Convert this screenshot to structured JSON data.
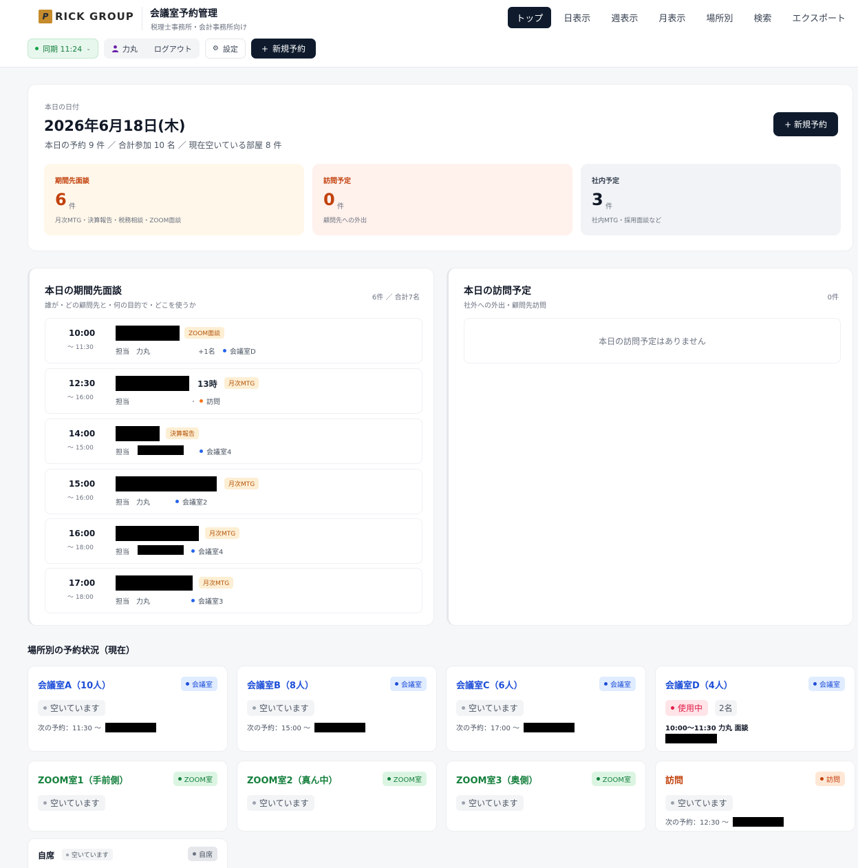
{
  "header": {
    "logo_mark": "P",
    "logo_text": "RICK GROUP",
    "app_title": "会議室予約管理",
    "app_subtitle": "税理士事務所・会計事務所向け",
    "nav": [
      "トップ",
      "日表示",
      "週表示",
      "月表示",
      "場所別",
      "検索",
      "エクスポート"
    ],
    "sync_label": "同期 11:24",
    "user_name": "力丸",
    "logout_label": "ログアウト",
    "settings_label": "設定",
    "new_label": "新規予約"
  },
  "summary": {
    "label": "本日の日付",
    "date": "2026年6月18日(木)",
    "stats": "本日の予約 9 件 ／ 合計参加 10 名 ／ 現在空いている部屋 8 件",
    "new_label": "新規予約",
    "boxes": [
      {
        "title": "期間先面談",
        "count": "6",
        "unit": "件",
        "desc": "月次MTG・決算報告・税務相談・ZOOM面談"
      },
      {
        "title": "訪問予定",
        "count": "0",
        "unit": "件",
        "desc": "顧問先への外出"
      },
      {
        "title": "社内予定",
        "count": "3",
        "unit": "件",
        "desc": "社内MTG・採用面談など"
      }
    ]
  },
  "meetings": {
    "title": "本日の期間先面談",
    "subtitle": "誰が・どの顧問先と・何の目的で・どこを使うか",
    "count": "6件 ／ 合計7名",
    "items": [
      {
        "start": "10:00",
        "end": "〜 11:30",
        "tag": "ZOOM面談",
        "staff": "担当　力丸",
        "extra": "+1名",
        "room": "会議室D"
      },
      {
        "start": "12:30",
        "end": "〜 16:00",
        "note": "13時",
        "tag": "月次MTG",
        "staff": "担当",
        "extra": "・",
        "room": "訪問"
      },
      {
        "start": "14:00",
        "end": "〜 15:00",
        "tag": "決算報告",
        "staff": "担当",
        "room": "会議室4"
      },
      {
        "start": "15:00",
        "end": "〜 16:00",
        "tag": "月次MTG",
        "staff": "担当　力丸",
        "room": "会議室2"
      },
      {
        "start": "16:00",
        "end": "〜 18:00",
        "tag": "月次MTG",
        "staff": "担当",
        "room": "会議室4"
      },
      {
        "start": "17:00",
        "end": "〜 18:00",
        "tag": "月次MTG",
        "staff": "担当　力丸",
        "room": "会議室3"
      }
    ]
  },
  "visits": {
    "title": "本日の訪問予定",
    "subtitle": "社外への外出・顧問先訪問",
    "count": "0件",
    "empty": "本日の訪問予定はありません"
  },
  "locations": {
    "title": "場所別の予約状況（現在）",
    "items": [
      {
        "name": "会議室A（10人）",
        "type": "会議室",
        "status": "空いています",
        "next": "次の予約：11:30 〜"
      },
      {
        "name": "会議室B（8人）",
        "type": "会議室",
        "status": "空いています",
        "next": "次の予約：15:00 〜"
      },
      {
        "name": "会議室C（6人）",
        "type": "会議室",
        "status": "空いています",
        "next": "次の予約：17:00 〜"
      },
      {
        "name": "会議室D（4人）",
        "type": "会議室",
        "status": "使用中",
        "people": "2名",
        "current": "10:00〜11:30 力丸 面談"
      },
      {
        "name": "ZOOM室1（手前側）",
        "type": "ZOOM室",
        "status": "空いています"
      },
      {
        "name": "ZOOM室2（真ん中）",
        "type": "ZOOM室",
        "status": "空いています"
      },
      {
        "name": "ZOOM室3（奥側）",
        "type": "ZOOM室",
        "status": "空いています"
      },
      {
        "name": "訪問",
        "type": "訪問",
        "status": "空いています",
        "next": "次の予約：12:30 〜"
      },
      {
        "name": "自席",
        "type": "自席",
        "status": "空いています"
      }
    ]
  },
  "colors": {
    "navy": "#0f1b2d",
    "blue": "#1d4ed8",
    "green": "#15803d",
    "orange": "#c2410c",
    "busy": "#e11d48"
  }
}
